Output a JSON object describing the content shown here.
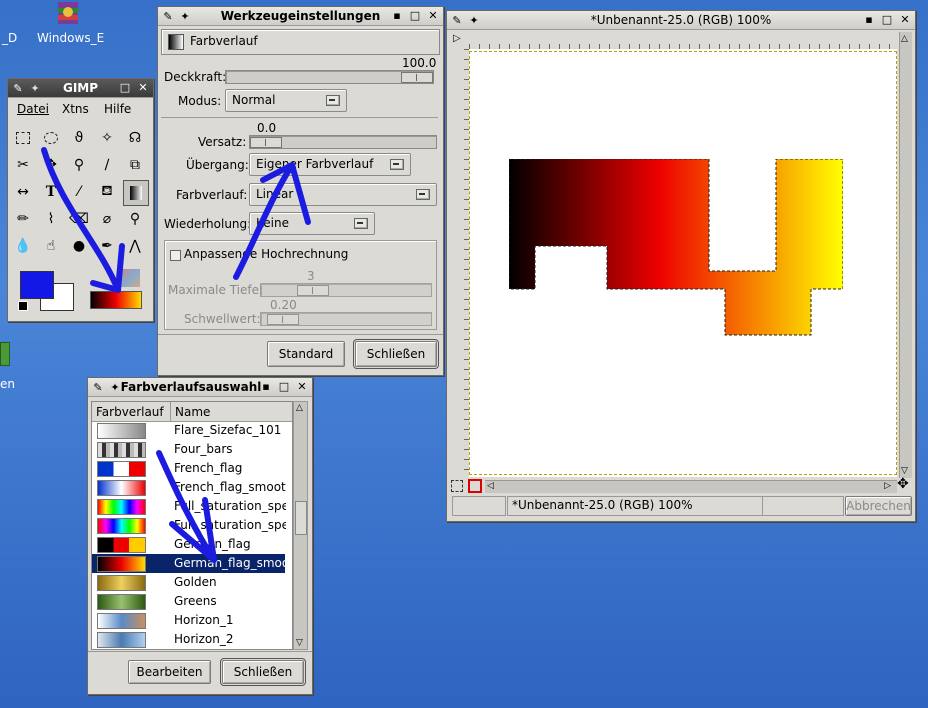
{
  "desktop": {
    "icon1_label": "_D",
    "icon2_label": "Windows_E",
    "icon3_label": "en"
  },
  "toolbox": {
    "title": "GIMP",
    "menu": [
      "Datei",
      "Xtns",
      "Hilfe"
    ]
  },
  "tool_options": {
    "title": "Werkzeugeinstellungen",
    "tool_name": "Farbverlauf",
    "opacity_value": "100.0",
    "opacity_label": "Deckkraft:",
    "mode_label": "Modus:",
    "mode_value": "Normal",
    "offset_value": "0.0",
    "offset_label": "Versatz:",
    "transition_label": "Übergang:",
    "transition_value": "Eigener Farbverlauf",
    "gradient_label": "Farbverlauf:",
    "gradient_value": "Linear",
    "repeat_label": "Wiederholung:",
    "repeat_value": "Keine",
    "adaptive_label": "Anpassende Hochrechnung",
    "max_depth_label": "Maximale Tiefe:",
    "max_depth_value": "3",
    "threshold_label": "Schwellwert:",
    "threshold_value": "0.20",
    "standard_button": "Standard",
    "close_button": "Schließen"
  },
  "image_window": {
    "title": "*Unbenannt-25.0 (RGB) 100%",
    "status_text": "*Unbenannt-25.0 (RGB) 100%",
    "cancel_button": "Abbrechen"
  },
  "gradient_selector": {
    "title": "Farbverlaufsauswahl",
    "col_gradient": "Farbverlauf",
    "col_name": "Name",
    "items": [
      {
        "name": "Flare_Sizefac_101",
        "colors": "linear-gradient(90deg,#fff,#888)"
      },
      {
        "name": "Four_bars",
        "colors": "repeating-linear-gradient(90deg,#ddd 0 4px,#333 4px 8px,#bbb 8px 12px)"
      },
      {
        "name": "French_flag",
        "colors": "linear-gradient(90deg,#0033cc 0 33%,#fff 33% 66%,#e00 66%)"
      },
      {
        "name": "French_flag_smooth",
        "colors": "linear-gradient(90deg,#0033cc,#fff,#e00)"
      },
      {
        "name": "Full_saturation_spectrum_CCW",
        "colors": "linear-gradient(90deg,#f00,#ff0,#0f0,#0ff,#00f,#f0f,#f00)"
      },
      {
        "name": "Full_saturation_spectrum_CW",
        "colors": "linear-gradient(90deg,#f00,#f0f,#00f,#0ff,#0f0,#ff0,#f00)"
      },
      {
        "name": "German_flag",
        "colors": "linear-gradient(90deg,#000 0 33%,#e00 33% 66%,#fc0 66%)"
      },
      {
        "name": "German_flag_smooth",
        "colors": "linear-gradient(90deg,#000,#e00,#fd0)",
        "selected": true
      },
      {
        "name": "Golden",
        "colors": "linear-gradient(90deg,#8a6a10,#f0d060,#8a6a10)"
      },
      {
        "name": "Greens",
        "colors": "linear-gradient(90deg,#2a5a10,#9ac070,#2a5a10)"
      },
      {
        "name": "Horizon_1",
        "colors": "linear-gradient(90deg,#fff,#5a8ac8,#c89060)"
      },
      {
        "name": "Horizon_2",
        "colors": "linear-gradient(90deg,#e0e8f0,#4a7ab0,#b0d0f0)"
      }
    ],
    "edit_button": "Bearbeiten",
    "close_button": "Schließen"
  },
  "colors": {
    "fg": "#1418e6",
    "bg": "#ffffff",
    "annotation": "#1c1ce0"
  }
}
